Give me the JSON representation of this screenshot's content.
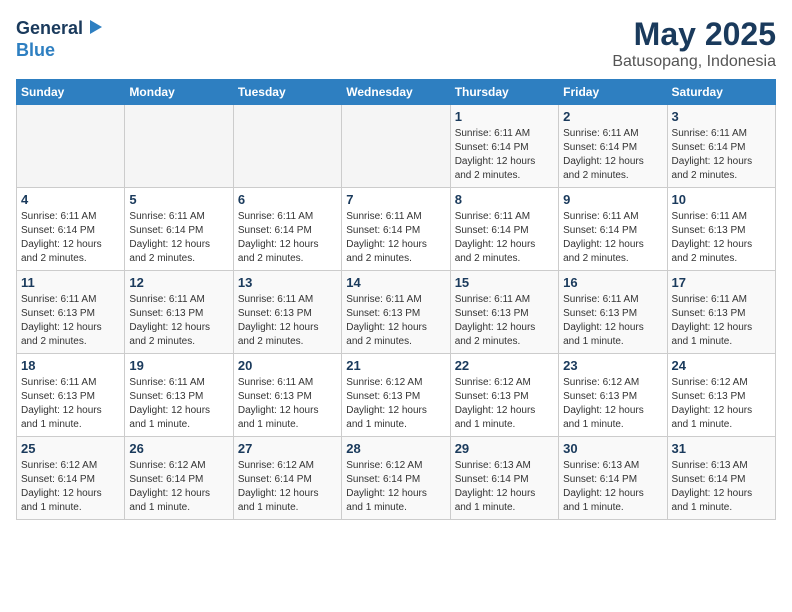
{
  "header": {
    "logo_line1": "General",
    "logo_line2": "Blue",
    "title": "May 2025",
    "subtitle": "Batusopang, Indonesia"
  },
  "calendar": {
    "days_of_week": [
      "Sunday",
      "Monday",
      "Tuesday",
      "Wednesday",
      "Thursday",
      "Friday",
      "Saturday"
    ],
    "weeks": [
      [
        {
          "day": "",
          "info": ""
        },
        {
          "day": "",
          "info": ""
        },
        {
          "day": "",
          "info": ""
        },
        {
          "day": "",
          "info": ""
        },
        {
          "day": "1",
          "info": "Sunrise: 6:11 AM\nSunset: 6:14 PM\nDaylight: 12 hours and 2 minutes."
        },
        {
          "day": "2",
          "info": "Sunrise: 6:11 AM\nSunset: 6:14 PM\nDaylight: 12 hours and 2 minutes."
        },
        {
          "day": "3",
          "info": "Sunrise: 6:11 AM\nSunset: 6:14 PM\nDaylight: 12 hours and 2 minutes."
        }
      ],
      [
        {
          "day": "4",
          "info": "Sunrise: 6:11 AM\nSunset: 6:14 PM\nDaylight: 12 hours and 2 minutes."
        },
        {
          "day": "5",
          "info": "Sunrise: 6:11 AM\nSunset: 6:14 PM\nDaylight: 12 hours and 2 minutes."
        },
        {
          "day": "6",
          "info": "Sunrise: 6:11 AM\nSunset: 6:14 PM\nDaylight: 12 hours and 2 minutes."
        },
        {
          "day": "7",
          "info": "Sunrise: 6:11 AM\nSunset: 6:14 PM\nDaylight: 12 hours and 2 minutes."
        },
        {
          "day": "8",
          "info": "Sunrise: 6:11 AM\nSunset: 6:14 PM\nDaylight: 12 hours and 2 minutes."
        },
        {
          "day": "9",
          "info": "Sunrise: 6:11 AM\nSunset: 6:14 PM\nDaylight: 12 hours and 2 minutes."
        },
        {
          "day": "10",
          "info": "Sunrise: 6:11 AM\nSunset: 6:13 PM\nDaylight: 12 hours and 2 minutes."
        }
      ],
      [
        {
          "day": "11",
          "info": "Sunrise: 6:11 AM\nSunset: 6:13 PM\nDaylight: 12 hours and 2 minutes."
        },
        {
          "day": "12",
          "info": "Sunrise: 6:11 AM\nSunset: 6:13 PM\nDaylight: 12 hours and 2 minutes."
        },
        {
          "day": "13",
          "info": "Sunrise: 6:11 AM\nSunset: 6:13 PM\nDaylight: 12 hours and 2 minutes."
        },
        {
          "day": "14",
          "info": "Sunrise: 6:11 AM\nSunset: 6:13 PM\nDaylight: 12 hours and 2 minutes."
        },
        {
          "day": "15",
          "info": "Sunrise: 6:11 AM\nSunset: 6:13 PM\nDaylight: 12 hours and 2 minutes."
        },
        {
          "day": "16",
          "info": "Sunrise: 6:11 AM\nSunset: 6:13 PM\nDaylight: 12 hours and 1 minute."
        },
        {
          "day": "17",
          "info": "Sunrise: 6:11 AM\nSunset: 6:13 PM\nDaylight: 12 hours and 1 minute."
        }
      ],
      [
        {
          "day": "18",
          "info": "Sunrise: 6:11 AM\nSunset: 6:13 PM\nDaylight: 12 hours and 1 minute."
        },
        {
          "day": "19",
          "info": "Sunrise: 6:11 AM\nSunset: 6:13 PM\nDaylight: 12 hours and 1 minute."
        },
        {
          "day": "20",
          "info": "Sunrise: 6:11 AM\nSunset: 6:13 PM\nDaylight: 12 hours and 1 minute."
        },
        {
          "day": "21",
          "info": "Sunrise: 6:12 AM\nSunset: 6:13 PM\nDaylight: 12 hours and 1 minute."
        },
        {
          "day": "22",
          "info": "Sunrise: 6:12 AM\nSunset: 6:13 PM\nDaylight: 12 hours and 1 minute."
        },
        {
          "day": "23",
          "info": "Sunrise: 6:12 AM\nSunset: 6:13 PM\nDaylight: 12 hours and 1 minute."
        },
        {
          "day": "24",
          "info": "Sunrise: 6:12 AM\nSunset: 6:13 PM\nDaylight: 12 hours and 1 minute."
        }
      ],
      [
        {
          "day": "25",
          "info": "Sunrise: 6:12 AM\nSunset: 6:14 PM\nDaylight: 12 hours and 1 minute."
        },
        {
          "day": "26",
          "info": "Sunrise: 6:12 AM\nSunset: 6:14 PM\nDaylight: 12 hours and 1 minute."
        },
        {
          "day": "27",
          "info": "Sunrise: 6:12 AM\nSunset: 6:14 PM\nDaylight: 12 hours and 1 minute."
        },
        {
          "day": "28",
          "info": "Sunrise: 6:12 AM\nSunset: 6:14 PM\nDaylight: 12 hours and 1 minute."
        },
        {
          "day": "29",
          "info": "Sunrise: 6:13 AM\nSunset: 6:14 PM\nDaylight: 12 hours and 1 minute."
        },
        {
          "day": "30",
          "info": "Sunrise: 6:13 AM\nSunset: 6:14 PM\nDaylight: 12 hours and 1 minute."
        },
        {
          "day": "31",
          "info": "Sunrise: 6:13 AM\nSunset: 6:14 PM\nDaylight: 12 hours and 1 minute."
        }
      ]
    ]
  }
}
